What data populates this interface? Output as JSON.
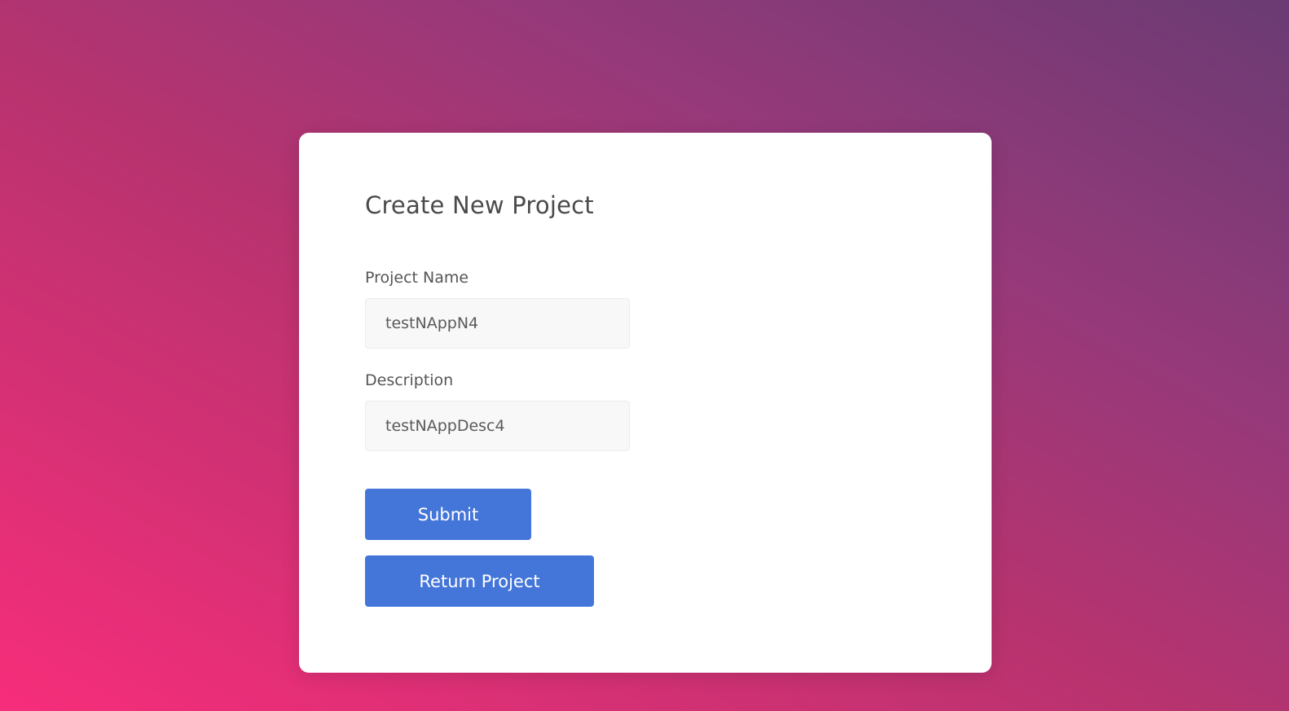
{
  "colors": {
    "background_start": "#f72d7a",
    "background_end": "#6a3b73",
    "card": "#ffffff",
    "button": "#4475d9",
    "button_text": "#ffffff",
    "title_text": "#4a4a4a"
  },
  "form": {
    "title": "Create New Project",
    "project_name": {
      "label": "Project Name",
      "value": "testNAppN4"
    },
    "description": {
      "label": "Description",
      "value": "testNAppDesc4"
    },
    "submit_label": "Submit",
    "return_label": "Return Project"
  }
}
